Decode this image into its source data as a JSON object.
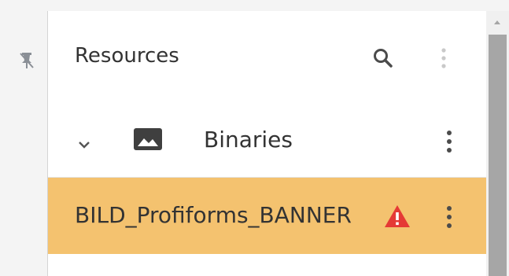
{
  "header": {
    "title": "Resources",
    "search_icon": "search-icon",
    "more_icon": "more-vertical-icon"
  },
  "rail": {
    "pin_icon": "pin-icon"
  },
  "tree": {
    "items": [
      {
        "label": "Binaries",
        "expanded": true,
        "icons": [
          "chevron-down-icon",
          "image-icon",
          "more-vertical-icon"
        ]
      },
      {
        "label": "BILD_Profiforms_BANNER",
        "selected": true,
        "status": "warning",
        "icons": [
          "warning-icon",
          "more-vertical-icon"
        ]
      }
    ]
  },
  "colors": {
    "selected_row": "#f4c26f",
    "warning": "#e53935",
    "text": "#333333",
    "rail_bg": "#f4f4f4",
    "scrollbar_thumb": "#a6a6a6"
  }
}
